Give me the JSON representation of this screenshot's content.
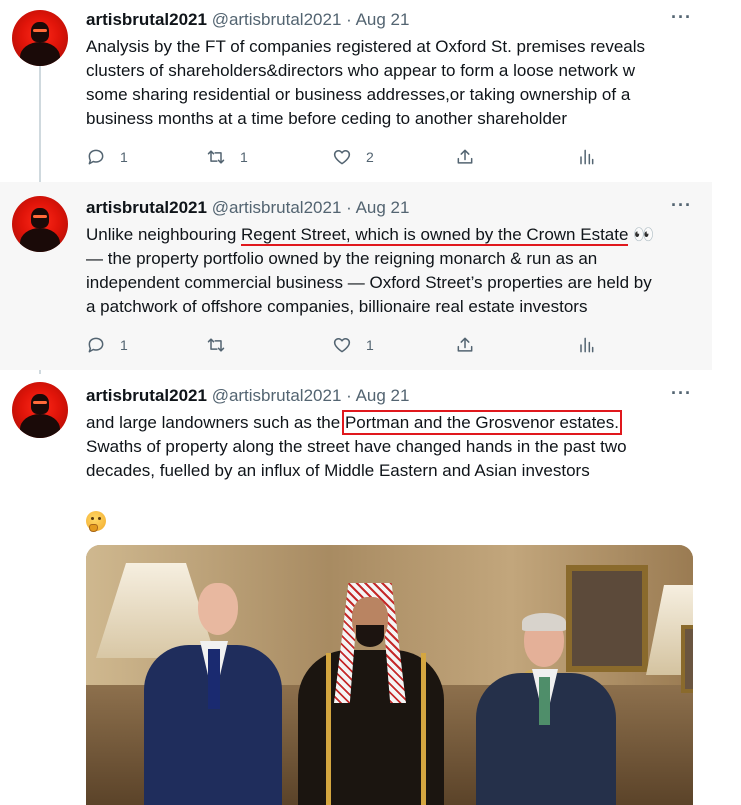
{
  "tweets": [
    {
      "author_name": "artisbrutal2021",
      "handle": "@artisbrutal2021",
      "separator": " · ",
      "date": "Aug 21",
      "more_label": "···",
      "lines": [
        "Analysis by the FT of companies registered at Oxford St. premises reveals",
        "clusters of shareholders&directors who appear to form a loose network w",
        "some sharing residential or business addresses,or taking ownership of a",
        "business months at a time before ceding to another shareholder"
      ],
      "reply_count": "1",
      "retweet_count": "1",
      "like_count": "2"
    },
    {
      "author_name": "artisbrutal2021",
      "handle": "@artisbrutal2021",
      "separator": " · ",
      "date": "Aug 21",
      "more_label": "···",
      "line1_pre": "Unlike neighbouring ",
      "line1_highlight": "Regent Street, which is owned by the Crown Estate",
      "line1_emoji": " 👀",
      "lines": [
        "— the property portfolio owned by the reigning monarch & run as an",
        "independent commercial business — Oxford Street’s properties are held by",
        "a patchwork of offshore companies, billionaire real estate investors"
      ],
      "reply_count": "1",
      "retweet_count": "",
      "like_count": "1"
    },
    {
      "author_name": "artisbrutal2021",
      "handle": "@artisbrutal2021",
      "separator": " · ",
      "date": "Aug 21",
      "more_label": "···",
      "line1_pre": "and large landowners such as the ",
      "line1_highlight": "Portman and the Grosvenor estates.",
      "lines": [
        "Swaths of property along the street have changed hands in the past two",
        "decades, fuelled by an influx of Middle Eastern and Asian investors"
      ],
      "emoji": "thinking-face",
      "photo": "three-men-in-formal-room"
    }
  ],
  "colors": {
    "accent_red": "#e0181d",
    "muted": "#536471",
    "highlight_bg": "#f7f7f7"
  }
}
